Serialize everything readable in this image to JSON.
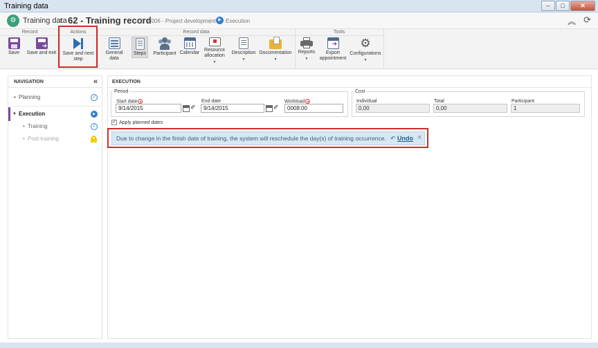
{
  "window": {
    "title": "Training data"
  },
  "header": {
    "app": "Training data",
    "separator": "›",
    "record": "62 - Training record",
    "project": "0006 - Project development",
    "step": "Execution"
  },
  "ribbon": {
    "groups": {
      "record": "Record",
      "actions": "Actions",
      "record_data": "Record data",
      "tools": "Tools"
    },
    "buttons": {
      "save": "Save",
      "save_exit": "Save and exit",
      "save_next_1": "Save and next",
      "save_next_2": "step",
      "general_data": "General data",
      "steps": "Steps",
      "participant": "Participant",
      "calendar": "Calendar",
      "resource_1": "Resource",
      "resource_2": "allocation",
      "description": "Description",
      "documentation": "Documentation",
      "reports": "Reports",
      "export_1": "Export",
      "export_2": "appointment",
      "configurations": "Configurations"
    }
  },
  "nav": {
    "title": "NAVIGATION",
    "items": [
      {
        "label": "Planning",
        "status": "done"
      },
      {
        "label": "Execution",
        "status": "current"
      },
      {
        "label": "Training",
        "status": "done"
      },
      {
        "label": "Post-training",
        "status": "locked"
      }
    ]
  },
  "main": {
    "title": "EXECUTION",
    "period": {
      "legend": "Period",
      "start_label": "Start date",
      "start_value": "9/14/2015",
      "end_label": "End date",
      "end_value": "9/14/2015",
      "workload_label": "Workload",
      "workload_value": "0008:00"
    },
    "cost": {
      "legend": "Cost",
      "individual_label": "Individual",
      "individual_value": "0,00",
      "total_label": "Total",
      "total_value": "0,00",
      "participant_label": "Participant",
      "participant_value": "1"
    },
    "apply_planned": {
      "label": "Apply planned dates",
      "checked": true
    }
  },
  "alert": {
    "message": "Due to change in the finish date of training, the system will reschedule the day(s) of training occurrence.",
    "undo": "Undo"
  },
  "colors": {
    "accent": "#2f7ed0",
    "highlight": "#d32a2a",
    "alert_bg": "#d8e8f3"
  }
}
